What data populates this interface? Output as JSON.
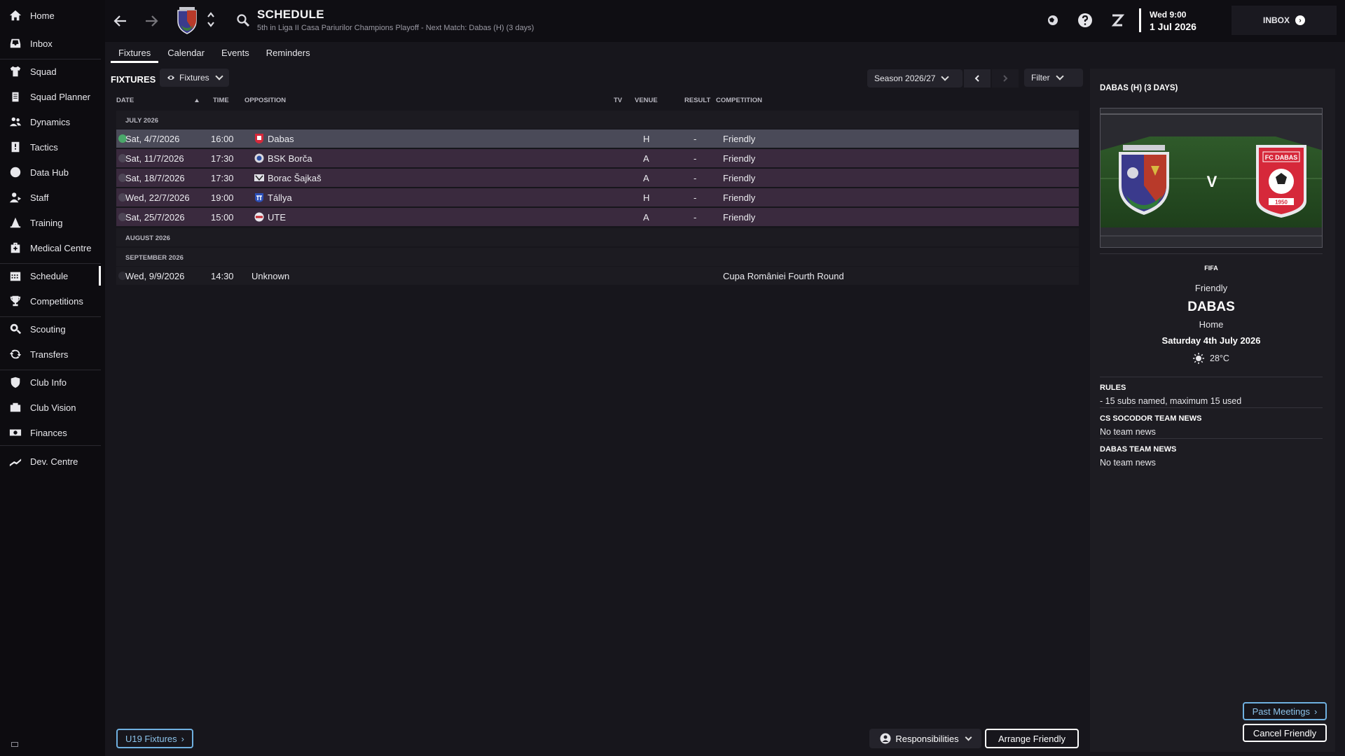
{
  "sidebar": {
    "items": [
      {
        "label": "Home",
        "icon": "home-icon"
      },
      {
        "label": "Inbox",
        "icon": "inbox-icon"
      },
      {
        "label": "Squad",
        "icon": "shirt-icon"
      },
      {
        "label": "Squad Planner",
        "icon": "clipboard-icon"
      },
      {
        "label": "Dynamics",
        "icon": "people-icon"
      },
      {
        "label": "Tactics",
        "icon": "board-icon"
      },
      {
        "label": "Data Hub",
        "icon": "chart-icon"
      },
      {
        "label": "Staff",
        "icon": "staff-icon"
      },
      {
        "label": "Training",
        "icon": "cone-icon"
      },
      {
        "label": "Medical Centre",
        "icon": "medical-icon"
      },
      {
        "label": "Schedule",
        "icon": "calendar-icon"
      },
      {
        "label": "Competitions",
        "icon": "trophy-icon"
      },
      {
        "label": "Scouting",
        "icon": "search-icon"
      },
      {
        "label": "Transfers",
        "icon": "transfer-icon"
      },
      {
        "label": "Club Info",
        "icon": "shield-icon"
      },
      {
        "label": "Club Vision",
        "icon": "vision-icon"
      },
      {
        "label": "Finances",
        "icon": "money-icon"
      },
      {
        "label": "Dev. Centre",
        "icon": "growth-icon"
      }
    ]
  },
  "header": {
    "title": "SCHEDULE",
    "subtitle": "5th in Liga II Casa Pariurilor Champions Playoff - Next Match: Dabas (H) (3 days)",
    "time": "Wed 9:00",
    "date": "1 Jul 2026",
    "inbox_label": "INBOX"
  },
  "tabs": [
    "Fixtures",
    "Calendar",
    "Events",
    "Reminders"
  ],
  "main": {
    "section_title": "FIXTURES",
    "view_pill": "Fixtures",
    "season_pill": "Season 2026/27",
    "filter_label": "Filter",
    "columns": {
      "date": "DATE",
      "time": "TIME",
      "opposition": "OPPOSITION",
      "tv": "TV",
      "venue": "VENUE",
      "result": "RESULT",
      "competition": "COMPETITION"
    },
    "months": [
      "JULY 2026",
      "AUGUST 2026",
      "SEPTEMBER 2026"
    ],
    "fixtures": [
      {
        "date": "Sat, 4/7/2026",
        "time": "16:00",
        "opposition": "Dabas",
        "venue": "H",
        "result": "-",
        "competition": "Friendly"
      },
      {
        "date": "Sat, 11/7/2026",
        "time": "17:30",
        "opposition": "BSK Borča",
        "venue": "A",
        "result": "-",
        "competition": "Friendly"
      },
      {
        "date": "Sat, 18/7/2026",
        "time": "17:30",
        "opposition": "Borac Šajkaš",
        "venue": "A",
        "result": "-",
        "competition": "Friendly"
      },
      {
        "date": "Wed, 22/7/2026",
        "time": "19:00",
        "opposition": "Tállya",
        "venue": "H",
        "result": "-",
        "competition": "Friendly"
      },
      {
        "date": "Sat, 25/7/2026",
        "time": "15:00",
        "opposition": "UTE",
        "venue": "A",
        "result": "-",
        "competition": "Friendly"
      }
    ],
    "september_fixture": {
      "date": "Wed, 9/9/2026",
      "time": "14:30",
      "opposition": "Unknown",
      "competition": "Cupa României Fourth Round"
    },
    "u19_button": "U19 Fixtures",
    "responsibilities_button": "Responsibilities",
    "arrange_button": "Arrange Friendly"
  },
  "match_panel": {
    "title": "DABAS (H) (3 DAYS)",
    "vs": "V",
    "org": "FIFA",
    "type": "Friendly",
    "opponent": "DABAS",
    "venue": "Home",
    "date": "Saturday 4th July 2026",
    "weather": "28°C",
    "opponent_crest_text": "FC DABAS",
    "opponent_crest_year": "1950",
    "rules_heading": "RULES",
    "rules_text": "- 15 subs named, maximum 15 used",
    "team_news_heading": "CS SOCODOR TEAM NEWS",
    "team_news_text": "No team news",
    "opp_news_heading": "DABAS TEAM NEWS",
    "opp_news_text": "No team news",
    "past_meetings_button": "Past Meetings",
    "cancel_button": "Cancel Friendly"
  },
  "colors": {
    "accent_blue": "#6fb0e0",
    "row_purple": "#3a2a3e",
    "selected_row": "#4a4a58",
    "status_green": "#4aa86a"
  }
}
